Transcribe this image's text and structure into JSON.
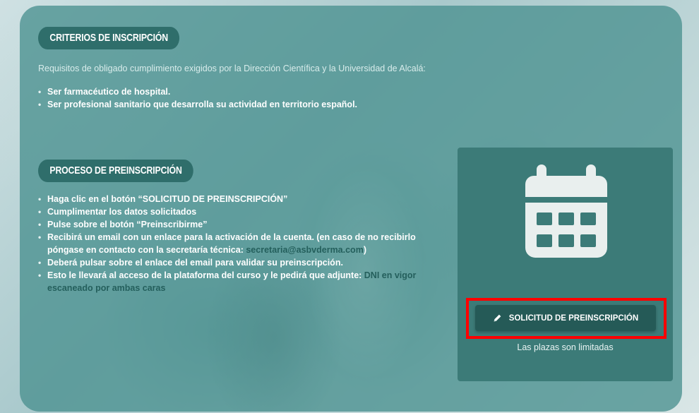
{
  "criterios": {
    "heading": "Criterios de inscripción",
    "intro": "Requisitos de obligado cumplimiento exigidos por la Dirección Científica y la Universidad de Alcalá:",
    "items": [
      "Ser farmacéutico de hospital.",
      "Ser profesional sanitario que desarrolla su actividad en territorio español."
    ]
  },
  "proceso": {
    "heading": "Proceso de preinscripción",
    "items": [
      "Haga clic en el botón “SOLICITUD DE PREINSCRIPCIÓN”",
      "Cumplimentar los datos solicitados",
      "Pulse sobre el botón “Preinscribirme”",
      "Deberá pulsar sobre el enlace del email para validar su preinscripción."
    ],
    "item4_prefix": "Recibirá un email con un enlace para la activación de la cuenta. (en caso de no recibirlo póngase en contacto con la secretaría técnica: ",
    "item4_email": "secretaria@asbvderma.com",
    "item4_suffix": ")",
    "item6_prefix": "Esto le llevará al acceso de la plataforma del curso y le pedirá que adjunte: ",
    "item6_highlight": "DNI en vigor escaneado por ambas caras"
  },
  "card": {
    "icon": "calendar-icon",
    "button_icon": "pencil-icon",
    "button_label": "SOLICITUD DE PREINSCRIPCIÓN",
    "note": "Las plazas son limitadas"
  },
  "colors": {
    "panel": "#4a918f",
    "pill": "#2f6e6b",
    "button": "#255a57",
    "highlight_box": "#ff0000",
    "email": "#245f5c"
  }
}
